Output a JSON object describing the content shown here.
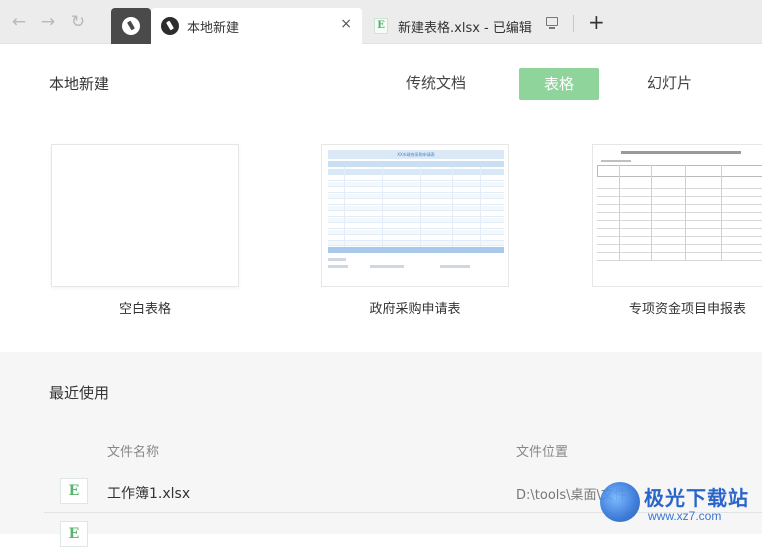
{
  "tabbar": {
    "home_icon": "logo-icon",
    "active_tab_title": "本地新建",
    "second_tab_title": "新建表格.xlsx - 已编辑",
    "close_glyph": "×",
    "add_glyph": "+"
  },
  "header": {
    "title": "本地新建",
    "categories": [
      "传统文档",
      "表格",
      "幻灯片"
    ],
    "selected_category": "表格",
    "accent_color": "#8fd49a"
  },
  "templates": [
    {
      "label": "空白表格"
    },
    {
      "label": "政府采购申请表",
      "sheet_title": "XX市政府采购申请表"
    },
    {
      "label": "专项资金项目申报表"
    }
  ],
  "recent": {
    "title": "最近使用",
    "columns": [
      "文件名称",
      "文件位置"
    ],
    "files": [
      {
        "name": "工作簿1.xlsx",
        "location": "D:\\tools\\桌面\\文件",
        "icon": "E"
      },
      {
        "name": "",
        "location": "",
        "icon": "E"
      }
    ]
  },
  "watermark": {
    "text": "极光下载站",
    "url": "www.xz7.com"
  }
}
